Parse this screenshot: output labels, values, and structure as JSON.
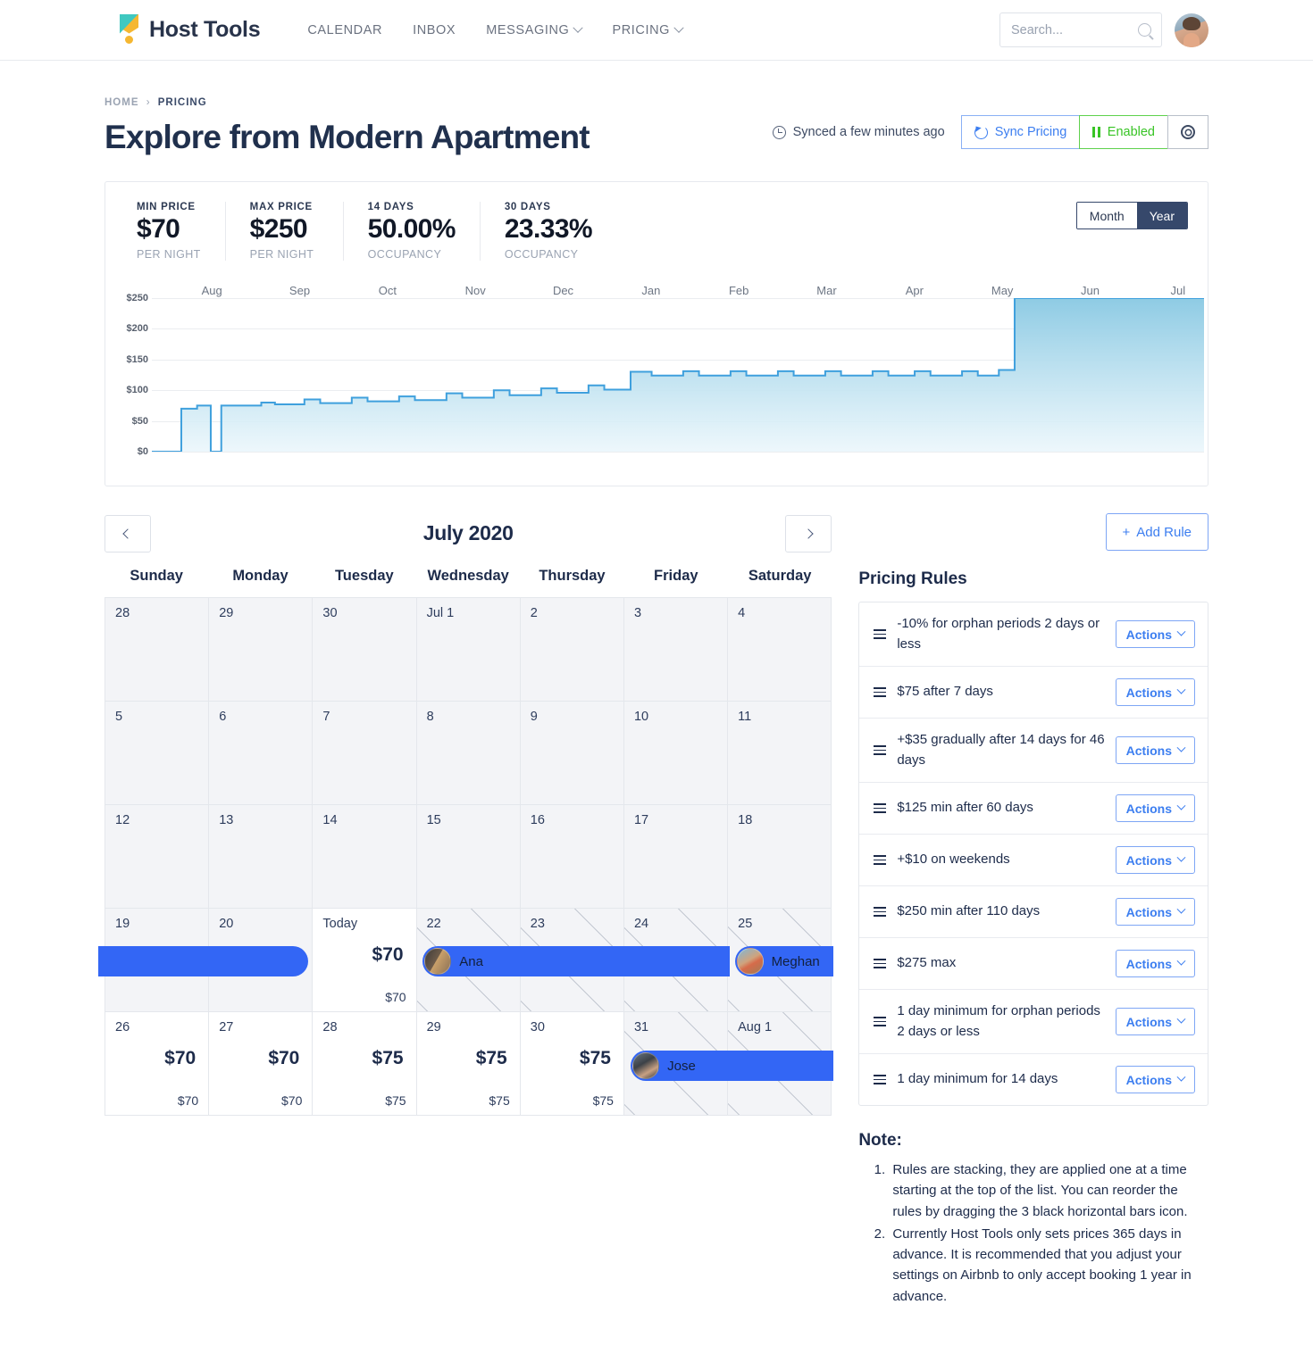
{
  "nav": {
    "brand": "Host Tools",
    "links": [
      {
        "label": "CALENDAR",
        "caret": false
      },
      {
        "label": "INBOX",
        "caret": false
      },
      {
        "label": "MESSAGING",
        "caret": true
      },
      {
        "label": "PRICING",
        "caret": true
      }
    ],
    "search_placeholder": "Search...",
    "search_value": ""
  },
  "breadcrumb": {
    "home": "HOME",
    "sep": "›",
    "current": "PRICING"
  },
  "header": {
    "title": "Explore from Modern Apartment",
    "sync_status": "Synced a few minutes ago",
    "sync_button": "Sync Pricing",
    "enabled_button": "Enabled",
    "accent_blue": "#3c7ef0",
    "accent_green": "#38c425"
  },
  "stats": [
    {
      "label": "MIN PRICE",
      "value": "$70",
      "sub": "PER NIGHT"
    },
    {
      "label": "MAX PRICE",
      "value": "$250",
      "sub": "PER NIGHT"
    },
    {
      "label": "14 DAYS",
      "value": "50.00%",
      "sub": "OCCUPANCY"
    },
    {
      "label": "30 DAYS",
      "value": "23.33%",
      "sub": "OCCUPANCY"
    }
  ],
  "range_toggle": {
    "month": "Month",
    "year": "Year",
    "selected": "Year"
  },
  "chart_data": {
    "type": "area",
    "title": "",
    "xlabel": "",
    "ylabel": "",
    "grid": true,
    "legend": null,
    "line_color": "#3fa0dd",
    "fill_top_color": "#8ecbe4",
    "fill_bottom_color": "#eaf6fb",
    "ylim": [
      0,
      250
    ],
    "yticks": [
      0,
      50,
      100,
      150,
      200,
      250
    ],
    "ytick_labels": [
      "$0",
      "$50",
      "$100",
      "$150",
      "$200",
      "$250"
    ],
    "xtick_labels": [
      "Aug",
      "Sep",
      "Oct",
      "Nov",
      "Dec",
      "Jan",
      "Feb",
      "Mar",
      "Apr",
      "May",
      "Jun",
      "Jul"
    ],
    "description": "Nightly price over 12 months: starts at $0, jumps to $70 in early Aug, dips to $0, then steps up gradually from $75 to ~$130 with weekend spikes through Nov, then jumps to $250 flat from mid-Nov through Jul",
    "steps": [
      {
        "x_pct": 0.0,
        "y": 0
      },
      {
        "x_pct": 2.8,
        "y": 0
      },
      {
        "x_pct": 2.8,
        "y": 70
      },
      {
        "x_pct": 4.3,
        "y": 70
      },
      {
        "x_pct": 4.3,
        "y": 75
      },
      {
        "x_pct": 5.6,
        "y": 75
      },
      {
        "x_pct": 5.6,
        "y": 0
      },
      {
        "x_pct": 6.6,
        "y": 0
      },
      {
        "x_pct": 6.6,
        "y": 75
      },
      {
        "x_pct": 10.4,
        "y": 75
      },
      {
        "x_pct": 10.4,
        "y": 80
      },
      {
        "x_pct": 11.7,
        "y": 80
      },
      {
        "x_pct": 11.7,
        "y": 77
      },
      {
        "x_pct": 14.5,
        "y": 77
      },
      {
        "x_pct": 14.5,
        "y": 85
      },
      {
        "x_pct": 16.0,
        "y": 85
      },
      {
        "x_pct": 16.0,
        "y": 79
      },
      {
        "x_pct": 19.0,
        "y": 79
      },
      {
        "x_pct": 19.0,
        "y": 88
      },
      {
        "x_pct": 20.5,
        "y": 88
      },
      {
        "x_pct": 20.5,
        "y": 82
      },
      {
        "x_pct": 23.5,
        "y": 82
      },
      {
        "x_pct": 23.5,
        "y": 90
      },
      {
        "x_pct": 25.0,
        "y": 90
      },
      {
        "x_pct": 25.0,
        "y": 84
      },
      {
        "x_pct": 28.0,
        "y": 84
      },
      {
        "x_pct": 28.0,
        "y": 95
      },
      {
        "x_pct": 29.5,
        "y": 95
      },
      {
        "x_pct": 29.5,
        "y": 88
      },
      {
        "x_pct": 32.5,
        "y": 88
      },
      {
        "x_pct": 32.5,
        "y": 100
      },
      {
        "x_pct": 34.0,
        "y": 100
      },
      {
        "x_pct": 34.0,
        "y": 92
      },
      {
        "x_pct": 37.0,
        "y": 92
      },
      {
        "x_pct": 37.0,
        "y": 103
      },
      {
        "x_pct": 38.5,
        "y": 103
      },
      {
        "x_pct": 38.5,
        "y": 96
      },
      {
        "x_pct": 41.5,
        "y": 96
      },
      {
        "x_pct": 41.5,
        "y": 108
      },
      {
        "x_pct": 43.0,
        "y": 108
      },
      {
        "x_pct": 43.0,
        "y": 101
      },
      {
        "x_pct": 45.5,
        "y": 101
      },
      {
        "x_pct": 45.5,
        "y": 130
      },
      {
        "x_pct": 47.5,
        "y": 130
      },
      {
        "x_pct": 47.5,
        "y": 124
      },
      {
        "x_pct": 50.5,
        "y": 124
      },
      {
        "x_pct": 50.5,
        "y": 131
      },
      {
        "x_pct": 52.0,
        "y": 131
      },
      {
        "x_pct": 52.0,
        "y": 124
      },
      {
        "x_pct": 55.0,
        "y": 124
      },
      {
        "x_pct": 55.0,
        "y": 131
      },
      {
        "x_pct": 56.5,
        "y": 131
      },
      {
        "x_pct": 56.5,
        "y": 124
      },
      {
        "x_pct": 59.5,
        "y": 124
      },
      {
        "x_pct": 59.5,
        "y": 131
      },
      {
        "x_pct": 61.0,
        "y": 131
      },
      {
        "x_pct": 61.0,
        "y": 124
      },
      {
        "x_pct": 64.0,
        "y": 124
      },
      {
        "x_pct": 64.0,
        "y": 131
      },
      {
        "x_pct": 65.5,
        "y": 131
      },
      {
        "x_pct": 65.5,
        "y": 124
      },
      {
        "x_pct": 68.5,
        "y": 124
      },
      {
        "x_pct": 68.5,
        "y": 131
      },
      {
        "x_pct": 70.0,
        "y": 131
      },
      {
        "x_pct": 70.0,
        "y": 124
      },
      {
        "x_pct": 72.5,
        "y": 124
      },
      {
        "x_pct": 72.5,
        "y": 131
      },
      {
        "x_pct": 74.0,
        "y": 131
      },
      {
        "x_pct": 74.0,
        "y": 124
      },
      {
        "x_pct": 77.0,
        "y": 124
      },
      {
        "x_pct": 77.0,
        "y": 131
      },
      {
        "x_pct": 78.5,
        "y": 131
      },
      {
        "x_pct": 78.5,
        "y": 124
      },
      {
        "x_pct": 80.5,
        "y": 124
      },
      {
        "x_pct": 80.5,
        "y": 133
      },
      {
        "x_pct": 82.0,
        "y": 133
      },
      {
        "x_pct": 82.0,
        "y": 250
      },
      {
        "x_pct": 100,
        "y": 250
      }
    ]
  },
  "calendar": {
    "prev_label": "‹",
    "next_label": "›",
    "month": "July 2020",
    "dow": [
      "Sunday",
      "Monday",
      "Tuesday",
      "Wednesday",
      "Thursday",
      "Friday",
      "Saturday"
    ],
    "weeks": [
      [
        {
          "day": "28",
          "state": "past"
        },
        {
          "day": "29",
          "state": "past"
        },
        {
          "day": "30",
          "state": "past"
        },
        {
          "day": "Jul 1",
          "state": "past"
        },
        {
          "day": "2",
          "state": "past"
        },
        {
          "day": "3",
          "state": "past"
        },
        {
          "day": "4",
          "state": "past"
        }
      ],
      [
        {
          "day": "5",
          "state": "past"
        },
        {
          "day": "6",
          "state": "past"
        },
        {
          "day": "7",
          "state": "past"
        },
        {
          "day": "8",
          "state": "past"
        },
        {
          "day": "9",
          "state": "past"
        },
        {
          "day": "10",
          "state": "past"
        },
        {
          "day": "11",
          "state": "past"
        }
      ],
      [
        {
          "day": "12",
          "state": "past"
        },
        {
          "day": "13",
          "state": "past"
        },
        {
          "day": "14",
          "state": "past"
        },
        {
          "day": "15",
          "state": "past"
        },
        {
          "day": "16",
          "state": "past"
        },
        {
          "day": "17",
          "state": "past"
        },
        {
          "day": "18",
          "state": "past"
        }
      ],
      [
        {
          "day": "19",
          "state": "past"
        },
        {
          "day": "20",
          "state": "past"
        },
        {
          "day": "Today",
          "state": "today",
          "price_big": "$70",
          "price_small": "$70"
        },
        {
          "day": "22",
          "state": "booked"
        },
        {
          "day": "23",
          "state": "booked"
        },
        {
          "day": "24",
          "state": "booked"
        },
        {
          "day": "25",
          "state": "booked"
        }
      ],
      [
        {
          "day": "26",
          "state": "normal",
          "price_big": "$70",
          "price_small": "$70"
        },
        {
          "day": "27",
          "state": "normal",
          "price_big": "$70",
          "price_small": "$70"
        },
        {
          "day": "28",
          "state": "normal",
          "price_big": "$75",
          "price_small": "$75"
        },
        {
          "day": "29",
          "state": "normal",
          "price_big": "$75",
          "price_small": "$75"
        },
        {
          "day": "30",
          "state": "normal",
          "price_big": "$75",
          "price_small": "$75"
        },
        {
          "day": "31",
          "state": "booked"
        },
        {
          "day": "Aug 1",
          "state": "booked"
        }
      ]
    ],
    "bookings": [
      {
        "guest": "",
        "avatar": "",
        "week": 3,
        "start_col": 0,
        "end_col": 2,
        "cap_left": false,
        "cap_right": true,
        "show_name": false
      },
      {
        "guest": "Ana",
        "avatar": "av-ana",
        "week": 3,
        "start_col": 3,
        "end_col": 6,
        "cap_left": true,
        "cap_right": false,
        "show_name": true
      },
      {
        "guest": "Meghan",
        "avatar": "av-meg",
        "week": 3,
        "start_col": 6,
        "end_col": 7,
        "cap_left": true,
        "cap_right": false,
        "show_name": true
      },
      {
        "guest": "Jose",
        "avatar": "av-jose",
        "week": 4,
        "start_col": 5,
        "end_col": 7,
        "cap_left": true,
        "cap_right": false,
        "show_name": true
      }
    ]
  },
  "rules_panel": {
    "add_rule": "Add Rule",
    "add_rule_plus": "+",
    "title": "Pricing Rules",
    "actions_label": "Actions",
    "rules": [
      {
        "text": "-10% for orphan periods 2 days or less"
      },
      {
        "text": "$75 after 7 days"
      },
      {
        "text": "+$35 gradually after 14 days for 46 days"
      },
      {
        "text": "$125 min after 60 days"
      },
      {
        "text": "+$10 on weekends"
      },
      {
        "text": "$250 min after 110 days"
      },
      {
        "text": "$275 max"
      },
      {
        "text": "1 day minimum for orphan periods 2 days or less"
      },
      {
        "text": "1 day minimum for 14 days"
      }
    ]
  },
  "note": {
    "title": "Note:",
    "items": [
      "Rules are stacking, they are applied one at a time starting at the top of the list. You can reorder the rules by dragging the 3 black horizontal bars icon.",
      "Currently Host Tools only sets prices 365 days in advance. It is recommended that you adjust your settings on Airbnb to only accept booking 1 year in advance."
    ]
  }
}
